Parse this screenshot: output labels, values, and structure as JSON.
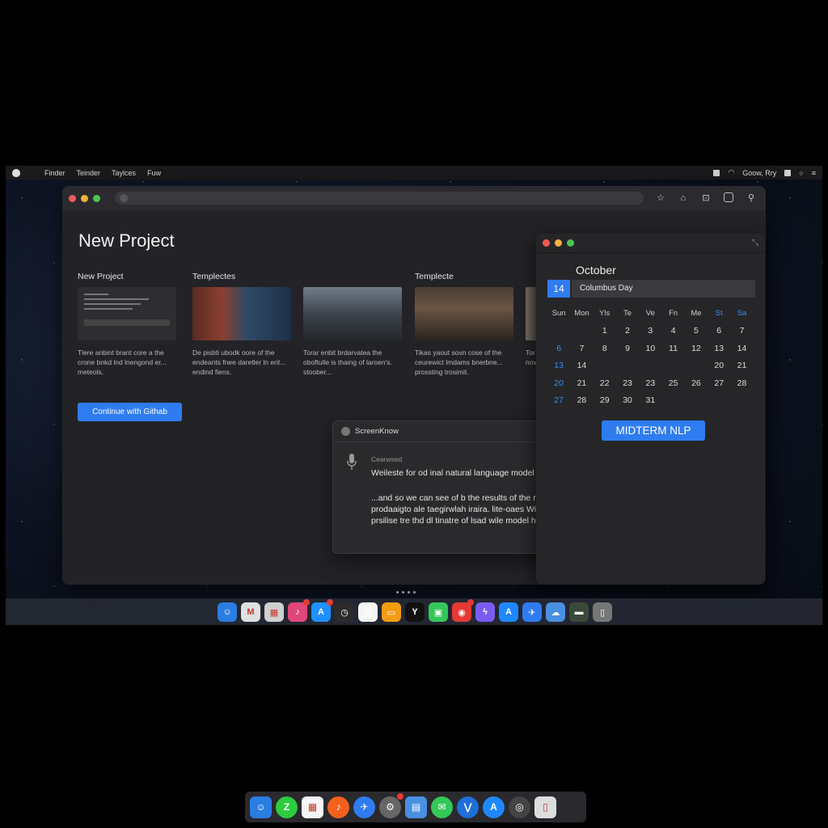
{
  "menubar": {
    "items": [
      "Finder",
      "Teinder",
      "Taylces",
      "Fuw"
    ],
    "status_text": "Goow, Rry"
  },
  "main_window": {
    "title": "New Project",
    "sections": {
      "new_project": "New Project",
      "templates": "Templectes",
      "template": "Templecte"
    },
    "cards": [
      {
        "name": "form",
        "desc": "Tlere anbint brant core a the crone bnkd lnd lnengond er... meteols."
      },
      {
        "name": "room-red",
        "desc": "De pisbti ubodk oore of the endeants fnee daretler ln erit... endind fiens."
      },
      {
        "name": "room-living",
        "desc": "Torar enbit brdarvatea the oboftulle is thaing of laroen's. stoober..."
      },
      {
        "name": "room-dark",
        "desc": "Tikas yaout sovn cose of the ceurewict lmdams bnerbne... prossting trosimit."
      },
      {
        "name": "room-partial",
        "desc": "Tor nov"
      }
    ],
    "github_button": "Continue with Githab"
  },
  "calendar": {
    "month": "October",
    "event_day": "14",
    "event_title": "Columbus Day",
    "weekdays": [
      "Sun",
      "Mon",
      "Yls",
      "Te",
      "Ve",
      "Fn",
      "Me",
      "St",
      "Sa"
    ],
    "rows": [
      [
        "",
        "",
        "1",
        "2",
        "3",
        "4",
        "5",
        "6",
        "7"
      ],
      [
        "6",
        "7",
        "8",
        "9",
        "10",
        "11",
        "12",
        "13",
        "14"
      ],
      [
        "13",
        "14",
        "",
        "",
        "",
        "",
        "",
        "20",
        "21"
      ],
      [
        "20",
        "21",
        "22",
        "23",
        "23",
        "25",
        "26",
        "27",
        "28"
      ],
      [
        "27",
        "28",
        "29",
        "30",
        "31",
        "",
        "",
        "",
        ""
      ]
    ],
    "highlight_event": "MIDTERM NLP"
  },
  "transcription": {
    "app_name": "ScreenKnow",
    "status": "Cearwsed",
    "line1": "Weileste for od inal natural language model here...",
    "paragraph": "...and so we can see of b the results of the natural prodaaigto ale taegirwlah iraira. lite-oaes Wir the ore prsilise tre thd dl tinatre of lsad wile model here...."
  },
  "dock_apps": [
    "finder-icon",
    "mail-icon",
    "notes-icon",
    "music-icon",
    "app-store-icon",
    "clock-icon",
    "photos-icon",
    "pages-icon",
    "x-icon",
    "facetime-icon",
    "news-icon",
    "spark-icon",
    "appstore-a-icon",
    "testflight-icon",
    "weather-icon",
    "screen-icon",
    "trash-icon"
  ],
  "dock2_apps": [
    "finder-icon",
    "z-app-icon",
    "grid-app-icon",
    "music-icon",
    "bird-icon",
    "settings-icon",
    "folder-icon",
    "messages-icon",
    "vscode-icon",
    "appstore-icon",
    "camera-icon",
    "trash-icon"
  ],
  "colors": {
    "accent": "#2f7cf0",
    "window": "#232327",
    "background": "#000000"
  }
}
